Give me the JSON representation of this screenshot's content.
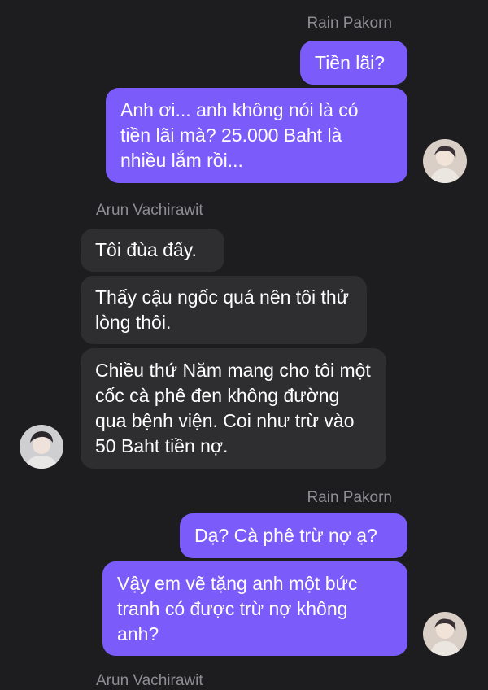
{
  "messages": [
    {
      "sender": "Rain Pakorn",
      "text": "Tiền lãi?"
    },
    {
      "sender": "Rain Pakorn",
      "text": "Anh ơi... anh không nói là có tiền lãi mà? 25.000 Baht là nhiều lắm rồi..."
    },
    {
      "sender": "Arun Vachirawit",
      "text": "Tôi đùa đấy."
    },
    {
      "sender": "Arun Vachirawit",
      "text": "Thấy cậu ngốc quá nên tôi thử lòng thôi."
    },
    {
      "sender": "Arun Vachirawit",
      "text": "Chiều thứ Năm mang cho tôi một cốc cà phê đen không đường qua bệnh viện. Coi như trừ vào 50 Baht tiền nợ."
    },
    {
      "sender": "Rain Pakorn",
      "text": "Dạ? Cà phê trừ nợ ạ?"
    },
    {
      "sender": "Rain Pakorn",
      "text": "Vậy em vẽ tặng anh một bức tranh có được trừ nợ không anh?"
    }
  ],
  "senders": {
    "rain": "Rain Pakorn",
    "arun": "Arun Vachirawit"
  },
  "colors": {
    "background": "#1d1d1f",
    "outgoing_bubble": "#7b5cfa",
    "incoming_bubble": "#2e2e31",
    "sender_name": "#8e8e93"
  }
}
